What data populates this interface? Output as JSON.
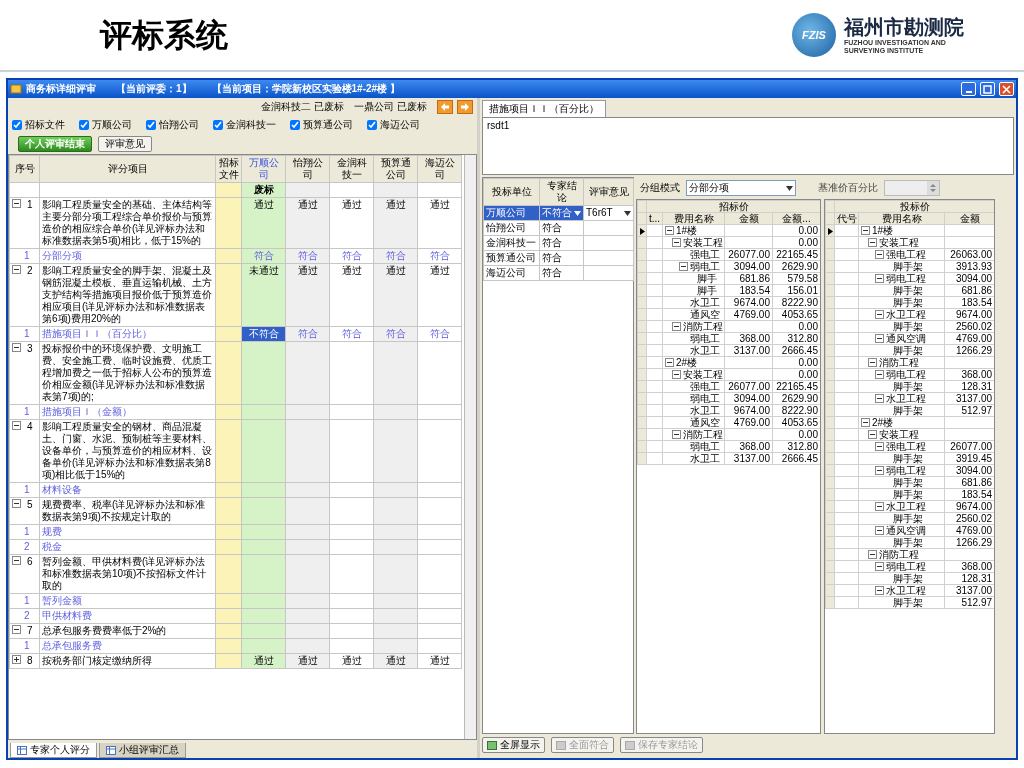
{
  "slide": {
    "title": "评标系统",
    "logo": {
      "abbr": "FZIS",
      "name": "福州市勘测院",
      "english_lines": [
        "FUZHOU INVESTIGATION AND",
        "SURVEYING INSTITUTE"
      ]
    }
  },
  "window": {
    "title": "商务标详细评审",
    "evaluator": "【当前评委：1】",
    "project": "【当前项目：学院新校区实验楼1#-2#楼 】"
  },
  "left": {
    "status": [
      {
        "company": "金润科技二",
        "state": "已废标"
      },
      {
        "company": "一鼎公司",
        "state": "已废标"
      }
    ],
    "filters": [
      {
        "label": "招标文件",
        "checked": true
      },
      {
        "label": "万顺公司",
        "checked": true
      },
      {
        "label": "怡翔公司",
        "checked": true
      },
      {
        "label": "金润科技一",
        "checked": true
      },
      {
        "label": "预算通公司",
        "checked": true
      },
      {
        "label": "海迈公司",
        "checked": true
      }
    ],
    "buttons": [
      {
        "label": "个人评审结束",
        "kind": "primary"
      },
      {
        "label": "评审意见",
        "kind": "plain"
      }
    ],
    "table": {
      "columns": [
        {
          "label": "序号",
          "kind": "number"
        },
        {
          "label": "评分项目",
          "kind": "item"
        },
        {
          "label": "招标文件",
          "kind": "tender"
        },
        {
          "label": "万顺公司",
          "kind": "bidder",
          "selected": true,
          "flag": "废标"
        },
        {
          "label": "怡翔公司",
          "kind": "bidder",
          "selected": false
        },
        {
          "label": "金润科技一",
          "kind": "bidder",
          "selected": false
        },
        {
          "label": "预算通公司",
          "kind": "bidder",
          "selected": false
        },
        {
          "label": "海迈公司",
          "kind": "bidder",
          "selected": false
        }
      ],
      "items": [
        {
          "no": "1",
          "expanded": true,
          "text": "影响工程质量安全的基础、主体结构等主要分部分项工程综合单价报价与预算造价的相应综合单价(详见评标办法和标准数据表第5项)相比，低于15%的",
          "results": [
            "通过",
            "通过",
            "通过",
            "通过",
            "通过"
          ],
          "subs": [
            {
              "no": "1",
              "name": "分部分项",
              "selected": false,
              "results": [
                "符合",
                "符合",
                "符合",
                "符合",
                "符合"
              ]
            }
          ]
        },
        {
          "no": "2",
          "expanded": true,
          "text": "影响工程质量安全的脚手架、混凝土及钢筋混凝土模板、垂直运输机械、土方支护结构等措施项目报价低于预算造价相应项目(详见评标办法和标准数据表第6项)费用20%的",
          "results": [
            "未通过",
            "通过",
            "通过",
            "通过",
            "通过"
          ],
          "subs": [
            {
              "no": "1",
              "name": "措施项目ＩＩ（百分比）",
              "selected": true,
              "results": [
                "不符合",
                "符合",
                "符合",
                "符合",
                "符合"
              ]
            }
          ]
        },
        {
          "no": "3",
          "expanded": true,
          "text": "投标报价中的环境保护费、文明施工费、安全施工费、临时设施费、优质工程增加费之一低于招标人公布的预算造价相应金额(详见评标办法和标准数据表第7项)的;",
          "subs": [
            {
              "no": "1",
              "name": "措施项目Ｉ（金额）",
              "selected": false
            }
          ]
        },
        {
          "no": "4",
          "expanded": true,
          "text": "影响工程质量安全的钢材、商品混凝土、门窗、水泥、预制桩等主要材料、设备单价，与预算造价的相应材料、设备单价(详见评标办法和标准数据表第8项)相比低于15%的",
          "subs": [
            {
              "no": "1",
              "name": "材料设备",
              "selected": false
            }
          ]
        },
        {
          "no": "5",
          "expanded": true,
          "text": "规费费率、税率(详见评标办法和标准数据表第9项)不按规定计取的",
          "subs": [
            {
              "no": "1",
              "name": "规费",
              "selected": false
            },
            {
              "no": "2",
              "name": "税金",
              "selected": false
            }
          ]
        },
        {
          "no": "6",
          "expanded": true,
          "text": "暂列金额、甲供材料费(详见评标办法和标准数据表第10项)不按招标文件计取的",
          "subs": [
            {
              "no": "1",
              "name": "暂列金额",
              "selected": false
            },
            {
              "no": "2",
              "name": "甲供材料费",
              "selected": false
            }
          ]
        },
        {
          "no": "7",
          "expanded": true,
          "text": "总承包服务费费率低于2%的",
          "subs": [
            {
              "no": "1",
              "name": "总承包服务费",
              "selected": false
            }
          ]
        },
        {
          "no": "8",
          "expanded": false,
          "text": "按税务部门核定缴纳所得",
          "results": [
            "通过",
            "通过",
            "通过",
            "通过",
            "通过"
          ]
        }
      ]
    },
    "tabs": [
      {
        "label": "专家个人评分",
        "selected": true
      },
      {
        "label": "小组评审汇总",
        "selected": false
      }
    ]
  },
  "right": {
    "tab": "措施项目ＩＩ（百分比）",
    "note": "rsdt1",
    "bidders": {
      "columns": [
        "投标单位",
        "专家结论",
        "评审意见"
      ],
      "rows": [
        {
          "unit": "万顺公司",
          "verdict": "不符合",
          "opinion": "T6r6T",
          "selected": true
        },
        {
          "unit": "怡翔公司",
          "verdict": "符合",
          "selected": false
        },
        {
          "unit": "金润科技一",
          "verdict": "符合",
          "selected": false
        },
        {
          "unit": "预算通公司",
          "verdict": "符合",
          "selected": false
        },
        {
          "unit": "海迈公司",
          "verdict": "符合",
          "selected": false
        }
      ]
    },
    "group_mode": {
      "label": "分组模式",
      "value": "分部分项"
    },
    "percent": {
      "label": "基准价百分比",
      "disabled": true
    },
    "tender_tree": {
      "title": "招标价",
      "columns": [
        "t...",
        "费用名称",
        "金额",
        "金额..."
      ],
      "rows": [
        {
          "name": "1#楼",
          "amount_2": "0.00",
          "expanded": true,
          "children": [
            {
              "name": "安装工程",
              "amount_2": "0.00",
              "expanded": true,
              "children": [
                {
                  "name": "强电工",
                  "amount_1": "26077.00",
                  "amount_2": "22165.45"
                },
                {
                  "name": "弱电工",
                  "amount_1": "3094.00",
                  "amount_2": "2629.90",
                  "expanded": true,
                  "children": [
                    {
                      "name": "脚手",
                      "amount_1": "681.86",
                      "amount_2": "579.58"
                    },
                    {
                      "name": "脚手",
                      "amount_1": "183.54",
                      "amount_2": "156.01"
                    }
                  ]
                },
                {
                  "name": "水卫工",
                  "amount_1": "9674.00",
                  "amount_2": "8222.90"
                },
                {
                  "name": "通风空",
                  "amount_1": "4769.00",
                  "amount_2": "4053.65"
                }
              ]
            },
            {
              "name": "消防工程",
              "amount_2": "0.00",
              "expanded": true,
              "children": [
                {
                  "name": "弱电工",
                  "amount_1": "368.00",
                  "amount_2": "312.80"
                },
                {
                  "name": "水卫工",
                  "amount_1": "3137.00",
                  "amount_2": "2666.45"
                }
              ]
            }
          ]
        },
        {
          "name": "2#楼",
          "amount_2": "0.00",
          "expanded": true,
          "children": [
            {
              "name": "安装工程",
              "amount_2": "0.00",
              "expanded": true,
              "children": [
                {
                  "name": "强电工",
                  "amount_1": "26077.00",
                  "amount_2": "22165.45"
                },
                {
                  "name": "弱电工",
                  "amount_1": "3094.00",
                  "amount_2": "2629.90"
                },
                {
                  "name": "水卫工",
                  "amount_1": "9674.00",
                  "amount_2": "8222.90"
                },
                {
                  "name": "通风空",
                  "amount_1": "4769.00",
                  "amount_2": "4053.65"
                }
              ]
            },
            {
              "name": "消防工程",
              "amount_2": "0.00",
              "expanded": true,
              "children": [
                {
                  "name": "弱电工",
                  "amount_1": "368.00",
                  "amount_2": "312.80"
                },
                {
                  "name": "水卫工",
                  "amount_1": "3137.00",
                  "amount_2": "2666.45"
                }
              ]
            }
          ]
        }
      ]
    },
    "bid_tree": {
      "title": "投标价",
      "columns": [
        "代号",
        "费用名称",
        "金额"
      ],
      "rows": [
        {
          "name": "1#楼",
          "expanded": true,
          "children": [
            {
              "name": "安装工程",
              "expanded": true,
              "children": [
                {
                  "name": "强电工程",
                  "amount": "26063.00",
                  "expanded": true,
                  "children": [
                    {
                      "name": "脚手架",
                      "amount": "3913.93"
                    }
                  ]
                },
                {
                  "name": "弱电工程",
                  "amount": "3094.00",
                  "expanded": true,
                  "children": [
                    {
                      "name": "脚手架",
                      "amount": "681.86"
                    },
                    {
                      "name": "脚手架",
                      "amount": "183.54"
                    }
                  ]
                },
                {
                  "name": "水卫工程",
                  "amount": "9674.00",
                  "expanded": true,
                  "children": [
                    {
                      "name": "脚手架",
                      "amount": "2560.02"
                    }
                  ]
                },
                {
                  "name": "通风空调",
                  "amount": "4769.00",
                  "expanded": true,
                  "children": [
                    {
                      "name": "脚手架",
                      "amount": "1266.29"
                    }
                  ]
                }
              ]
            },
            {
              "name": "消防工程",
              "expanded": true,
              "children": [
                {
                  "name": "弱电工程",
                  "amount": "368.00",
                  "expanded": true,
                  "children": [
                    {
                      "name": "脚手架",
                      "amount": "128.31"
                    }
                  ]
                },
                {
                  "name": "水卫工程",
                  "amount": "3137.00",
                  "expanded": true,
                  "children": [
                    {
                      "name": "脚手架",
                      "amount": "512.97"
                    }
                  ]
                }
              ]
            }
          ]
        },
        {
          "name": "2#楼",
          "expanded": true,
          "children": [
            {
              "name": "安装工程",
              "expanded": true,
              "children": [
                {
                  "name": "强电工程",
                  "amount": "26077.00",
                  "expanded": true,
                  "children": [
                    {
                      "name": "脚手架",
                      "amount": "3919.45"
                    }
                  ]
                },
                {
                  "name": "弱电工程",
                  "amount": "3094.00",
                  "expanded": true,
                  "children": [
                    {
                      "name": "脚手架",
                      "amount": "681.86"
                    },
                    {
                      "name": "脚手架",
                      "amount": "183.54"
                    }
                  ]
                },
                {
                  "name": "水卫工程",
                  "amount": "9674.00",
                  "expanded": true,
                  "children": [
                    {
                      "name": "脚手架",
                      "amount": "2560.02"
                    }
                  ]
                },
                {
                  "name": "通风空调",
                  "amount": "4769.00",
                  "expanded": true,
                  "children": [
                    {
                      "name": "脚手架",
                      "amount": "1266.29"
                    }
                  ]
                }
              ]
            },
            {
              "name": "消防工程",
              "expanded": true,
              "children": [
                {
                  "name": "弱电工程",
                  "amount": "368.00",
                  "expanded": true,
                  "children": [
                    {
                      "name": "脚手架",
                      "amount": "128.31"
                    }
                  ]
                },
                {
                  "name": "水卫工程",
                  "amount": "3137.00",
                  "expanded": true,
                  "children": [
                    {
                      "name": "脚手架",
                      "amount": "512.97"
                    }
                  ]
                }
              ]
            }
          ]
        }
      ]
    },
    "buttons": [
      {
        "label": "全屏显示",
        "disabled": false
      },
      {
        "label": "全面符合",
        "disabled": true
      },
      {
        "label": "保存专家结论",
        "disabled": true
      }
    ]
  }
}
